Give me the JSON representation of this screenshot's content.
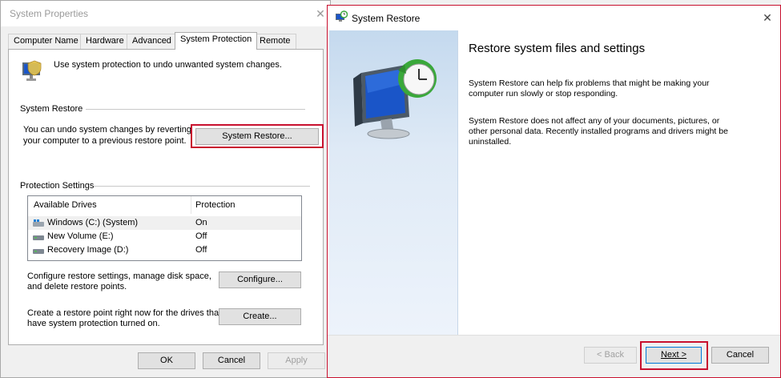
{
  "system_properties": {
    "title": "System Properties",
    "tabs": [
      "Computer Name",
      "Hardware",
      "Advanced",
      "System Protection",
      "Remote"
    ],
    "active_tab": "System Protection",
    "intro_text": "Use system protection to undo unwanted system changes.",
    "system_restore_group": {
      "label": "System Restore",
      "description_line1": "You can undo system changes by reverting",
      "description_line2": "your computer to a previous restore point.",
      "button": "System Restore..."
    },
    "protection_settings": {
      "label": "Protection Settings",
      "columns": [
        "Available Drives",
        "Protection"
      ],
      "drives": [
        {
          "name": "Windows (C:) (System)",
          "protection": "On",
          "icon": "system-drive-icon"
        },
        {
          "name": "New Volume (E:)",
          "protection": "Off",
          "icon": "drive-icon"
        },
        {
          "name": "Recovery Image (D:)",
          "protection": "Off",
          "icon": "drive-icon"
        }
      ],
      "configure_text_line1": "Configure restore settings, manage disk space,",
      "configure_text_line2": "and delete restore points.",
      "configure_button": "Configure...",
      "create_text_line1": "Create a restore point right now for the drives that",
      "create_text_line2": "have system protection turned on.",
      "create_button": "Create..."
    },
    "footer": {
      "ok": "OK",
      "cancel": "Cancel",
      "apply": "Apply"
    }
  },
  "system_restore_wizard": {
    "title": "System Restore",
    "heading": "Restore system files and settings",
    "para1_line1": "System Restore can help fix problems that might be making your",
    "para1_line2": "computer run slowly or stop responding.",
    "para2_line1": "System Restore does not affect any of your documents, pictures, or",
    "para2_line2": "other personal data. Recently installed programs and drivers might be",
    "para2_line3": "uninstalled.",
    "back_button": "< Back",
    "next_button": "Next >",
    "cancel_button": "Cancel"
  },
  "colors": {
    "highlight": "#c8102e",
    "sidebar_gradient_top": "#c4d9ee",
    "monitor_screen": "#1a55c8",
    "clock_arrow": "#3aa83a"
  }
}
